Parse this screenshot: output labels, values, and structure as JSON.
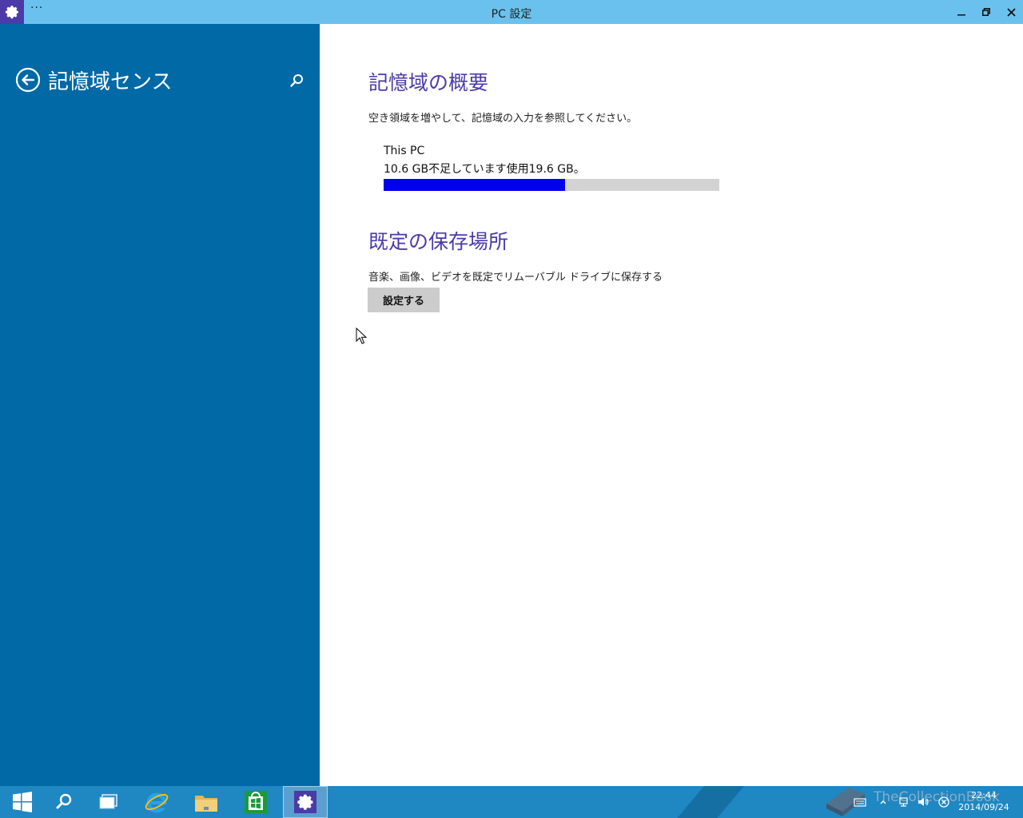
{
  "window": {
    "title": "PC 設定",
    "menu_label": "···"
  },
  "sidebar": {
    "title": "記憶域センス"
  },
  "overview": {
    "heading": "記憶域の概要",
    "description": "空き領域を増やして、記憶域の入力を参照してください。",
    "drive_name": "This PC",
    "usage_text": "10.6 GB不足しています使用19.6 GB。",
    "usage_fraction": 0.54
  },
  "default_save": {
    "heading": "既定の保存場所",
    "description": "音楽、画像、ビデオを既定でリムーバブル ドライブに保存する",
    "button_label": "設定する"
  },
  "taskbar": {
    "clock_time": "22:44",
    "clock_date": "2014/09/24",
    "watermark": "TheCollectionBook"
  },
  "colors": {
    "titlebar": "#6ac1ee",
    "sidebar": "#0069a6",
    "heading": "#4a3aaa",
    "usage_fill": "#0000ee",
    "taskbar": "#1f87c2"
  }
}
